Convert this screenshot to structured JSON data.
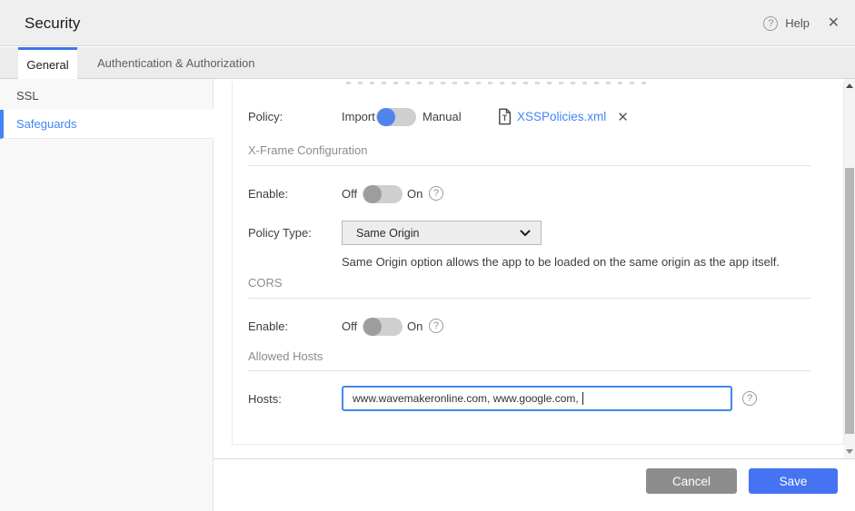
{
  "header": {
    "title": "Security",
    "help_label": "Help"
  },
  "tabs": [
    {
      "label": "General",
      "active": true
    },
    {
      "label": "Authentication & Authorization",
      "active": false
    }
  ],
  "sidebar": {
    "items": [
      {
        "label": "SSL",
        "selected": false
      },
      {
        "label": "Safeguards",
        "selected": true
      }
    ]
  },
  "panel": {
    "policy": {
      "label": "Policy:",
      "left_option": "Import",
      "right_option": "Manual",
      "file_name": "XSSPolicies.xml"
    },
    "xframe": {
      "heading": "X-Frame Configuration",
      "enable_label": "Enable:",
      "off": "Off",
      "on": "On",
      "policy_type_label": "Policy Type:",
      "policy_type_value": "Same Origin",
      "helper_text": "Same Origin option allows the app to be loaded on the same origin as the app itself."
    },
    "cors": {
      "heading": "CORS",
      "enable_label": "Enable:",
      "off": "Off",
      "on": "On"
    },
    "allowed_hosts": {
      "heading": "Allowed Hosts",
      "hosts_label": "Hosts:",
      "hosts_value": "www.wavemakeronline.com, www.google.com, "
    }
  },
  "footer": {
    "cancel_label": "Cancel",
    "save_label": "Save"
  },
  "colors": {
    "accent_blue": "#4285f4",
    "toggle_on_blue": "#5083ec",
    "toggle_off_gray": "#9d9d9d",
    "save_button_blue": "#4573f2",
    "cancel_button_gray": "#8d8d8d",
    "header_bg": "#efefef",
    "sidebar_bg": "#f8f8f8"
  }
}
